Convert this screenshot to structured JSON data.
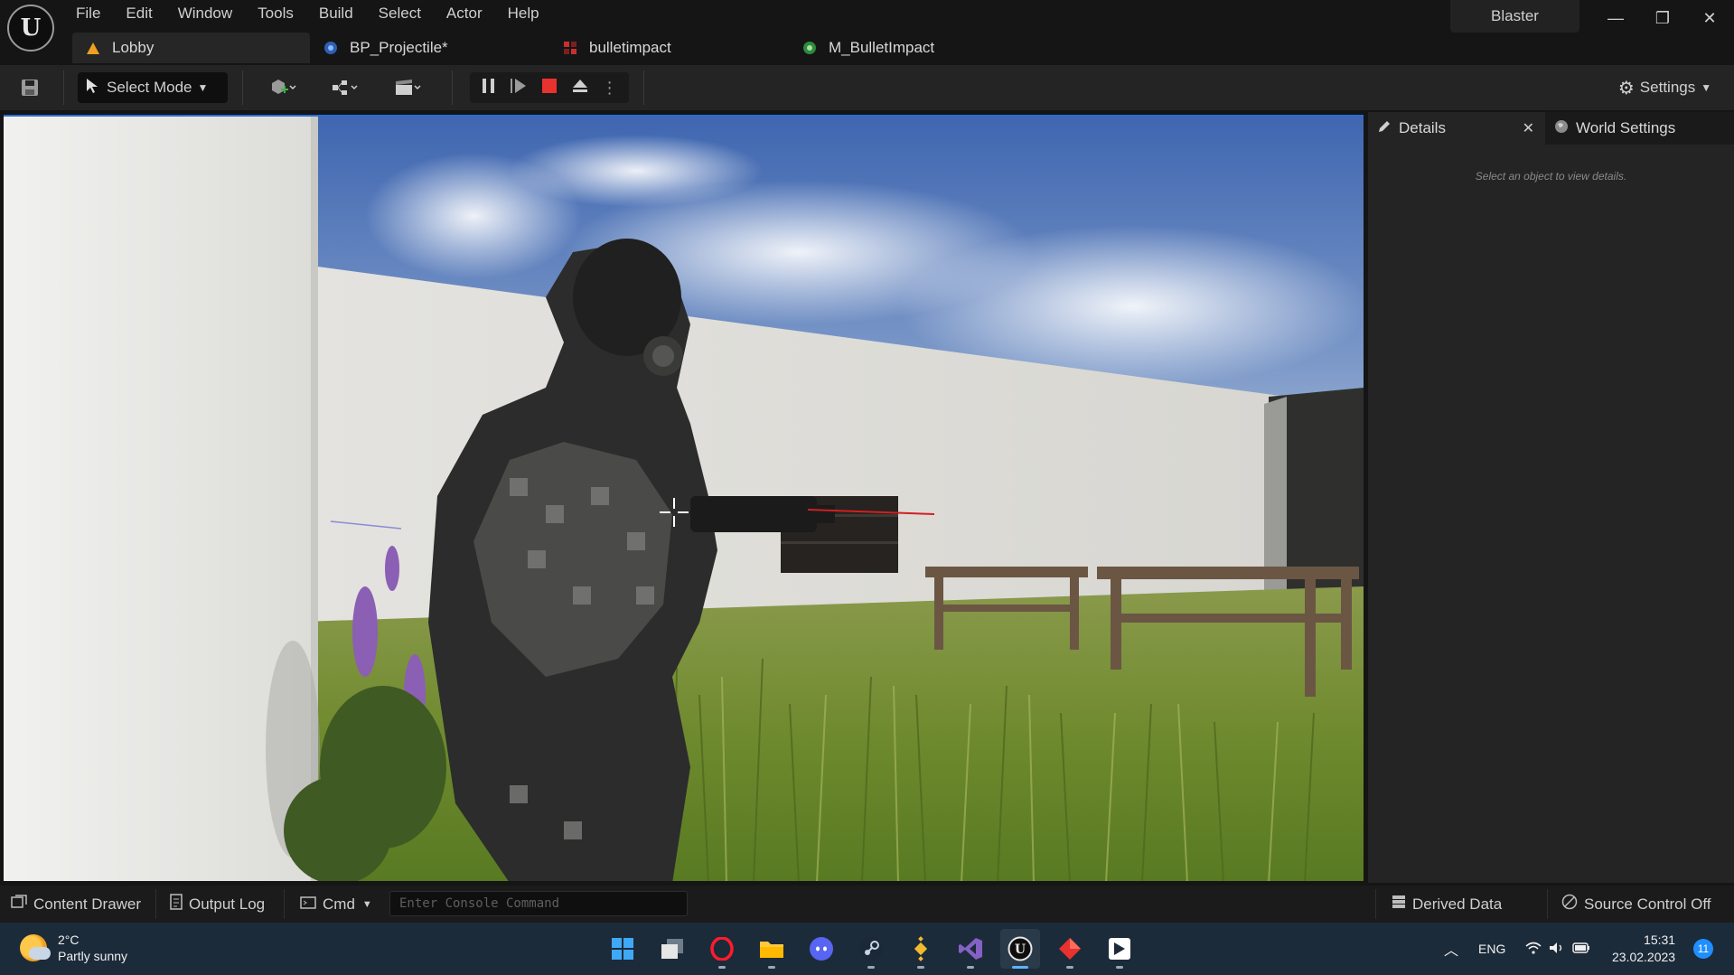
{
  "menu": [
    "File",
    "Edit",
    "Window",
    "Tools",
    "Build",
    "Select",
    "Actor",
    "Help"
  ],
  "project_name": "Blaster",
  "window_buttons": {
    "minimize": "—",
    "restore": "❐",
    "close": "✕"
  },
  "tabs": [
    {
      "label": "Lobby",
      "icon": "level-icon",
      "active": true
    },
    {
      "label": "BP_Projectile*",
      "icon": "blueprint-icon",
      "active": false
    },
    {
      "label": "bulletimpact",
      "icon": "niagara-icon",
      "active": false
    },
    {
      "label": "M_BulletImpact",
      "icon": "material-icon",
      "active": false
    }
  ],
  "toolbar": {
    "select_mode": "Select Mode",
    "settings": "Settings"
  },
  "details_panel": {
    "tab_details": "Details",
    "tab_world_settings": "World Settings",
    "hint": "Select an object to view details."
  },
  "statusbar": {
    "content_drawer": "Content Drawer",
    "output_log": "Output Log",
    "cmd": "Cmd",
    "console_placeholder": "Enter Console Command",
    "derived_data": "Derived Data",
    "source_control": "Source Control Off"
  },
  "taskbar": {
    "temperature": "2°C",
    "weather": "Partly sunny",
    "language": "ENG",
    "time": "15:31",
    "date": "23.02.2023",
    "notifications": "11",
    "apps": [
      "windows-start-icon",
      "task-view-icon",
      "opera-icon",
      "file-explorer-icon",
      "discord-icon",
      "steam-icon",
      "binance-icon",
      "visual-studio-icon",
      "unreal-engine-icon",
      "red-diamond-app-icon",
      "rider-app-icon"
    ]
  },
  "colors": {
    "accent_blue": "#2a6dd6",
    "stop_red": "#e8322f",
    "taskbar_bg": "#1c2b3a"
  }
}
